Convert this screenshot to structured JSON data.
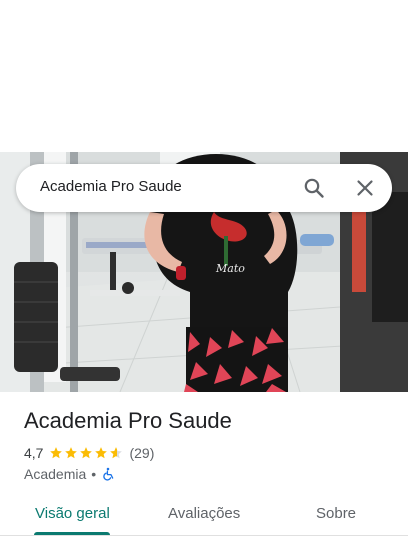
{
  "search": {
    "query": "Academia Pro Saude",
    "search_icon": "search-icon",
    "close_icon": "close-icon"
  },
  "place": {
    "name": "Academia Pro Saude",
    "rating": "4,7",
    "rating_stars_fraction": 0.94,
    "review_count": "(29)",
    "category": "Academia",
    "separator": "•",
    "accessibility_icon": "wheelchair-icon"
  },
  "tabs": [
    {
      "label": "Visão geral",
      "selected": true
    },
    {
      "label": "Avaliações",
      "selected": false
    },
    {
      "label": "Sobre",
      "selected": false
    }
  ],
  "colors": {
    "accent": "#0b7a70",
    "star": "#fbbc04",
    "text_primary": "#202124",
    "text_secondary": "#5f6368",
    "wheelchair": "#1a73e8"
  }
}
